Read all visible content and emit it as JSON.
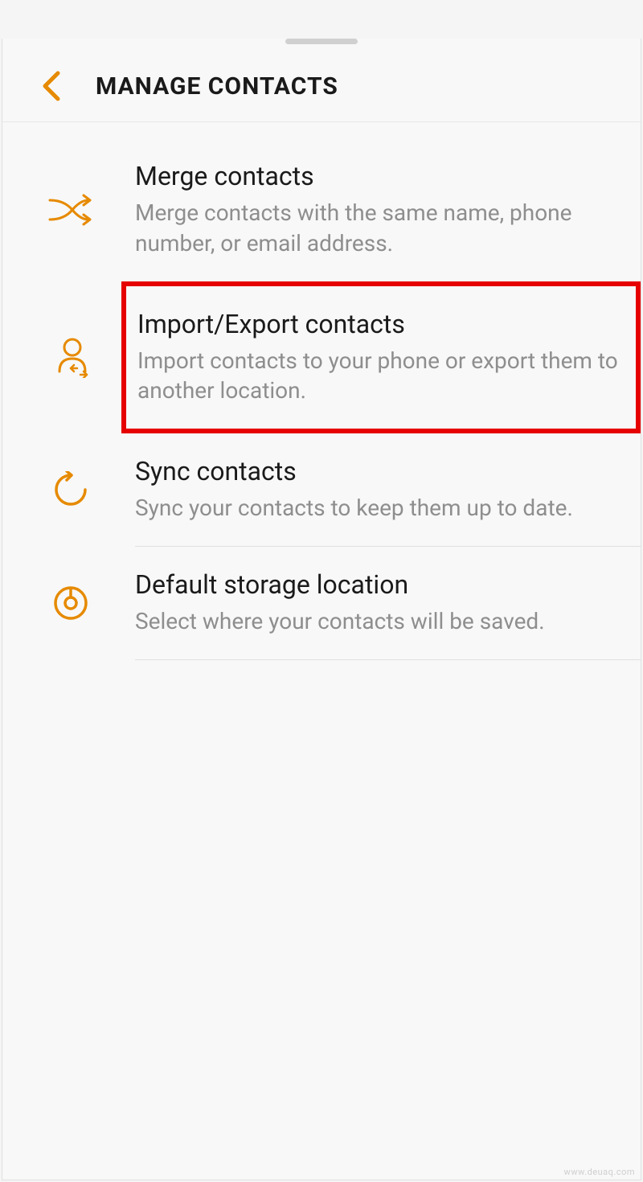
{
  "header": {
    "title": "MANAGE CONTACTS"
  },
  "items": [
    {
      "title": "Merge contacts",
      "desc": "Merge contacts with the same name, phone number, or email address."
    },
    {
      "title": "Import/Export contacts",
      "desc": "Import contacts to your phone or export them to another location."
    },
    {
      "title": "Sync contacts",
      "desc": "Sync your contacts to keep them up to date."
    },
    {
      "title": "Default storage location",
      "desc": "Select where your contacts will be saved."
    }
  ],
  "watermark": "www.deuaq.com"
}
